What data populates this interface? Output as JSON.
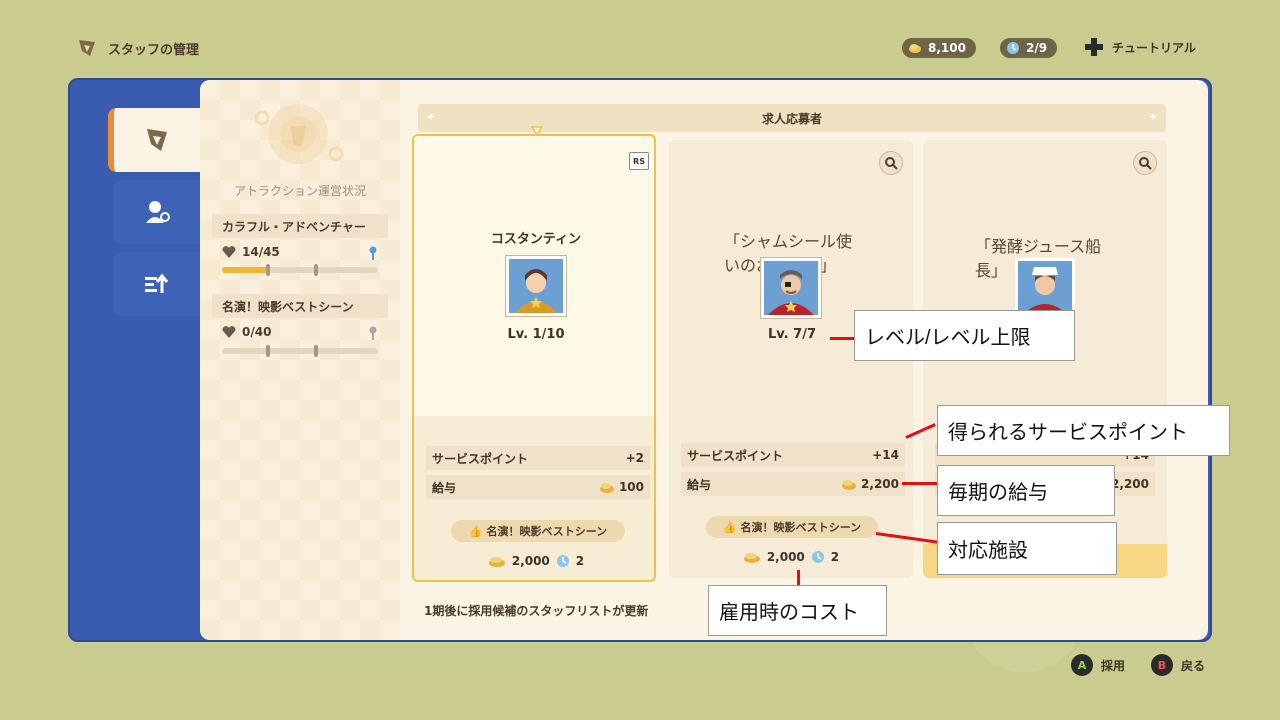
{
  "header": {
    "title": "スタッフの管理",
    "money": "8,100",
    "period": "2/9",
    "tutorial": "チュートリアル"
  },
  "sidebar": {
    "status_title": "アトラクション運営状況",
    "attractions": [
      {
        "name": "カラフル・アドベンチャー",
        "value": "14/45",
        "progress": 0.31
      },
      {
        "name": "名演！映影ベストシーン",
        "value": "0/40",
        "progress": 0.0
      }
    ]
  },
  "main": {
    "section_title": "求人応募者",
    "cards": [
      {
        "title": "",
        "name": "コスタンティン",
        "level": "Lv. 1/10",
        "badge": "RS",
        "service_label": "サービスポイント",
        "service_value": "+2",
        "salary_label": "給与",
        "salary_value": "100",
        "facility": "名演！映影ベストシーン",
        "cost_money": "2,000",
        "cost_period": "2"
      },
      {
        "title": "「シャムシール使いのおっさん」",
        "name": "",
        "level": "Lv. 7/7",
        "service_label": "サービスポイント",
        "service_value": "+14",
        "salary_label": "給与",
        "salary_value": "2,200",
        "facility": "名演！映影ベストシーン",
        "cost_money": "2,000",
        "cost_period": "2"
      },
      {
        "title": "「発酵ジュース船長」",
        "service_value": "+14",
        "salary_value": "2,200"
      }
    ],
    "footer_note": "1期後に採用候補のスタッフリストが更新"
  },
  "annotations": {
    "level": "レベル/レベル上限",
    "service": "得られるサービスポイント",
    "salary": "毎期の給与",
    "facility": "対応施設",
    "cost": "雇用時のコスト"
  },
  "buttons": {
    "hire_key": "A",
    "hire": "採用",
    "back_key": "B",
    "back": "戻る"
  },
  "colors": {
    "background": "#c9cc8e",
    "frame_blue": "#3a5cae",
    "panel": "#fbf4e4",
    "selected_border": "#f0c14a",
    "annotation_line": "#e21010"
  }
}
